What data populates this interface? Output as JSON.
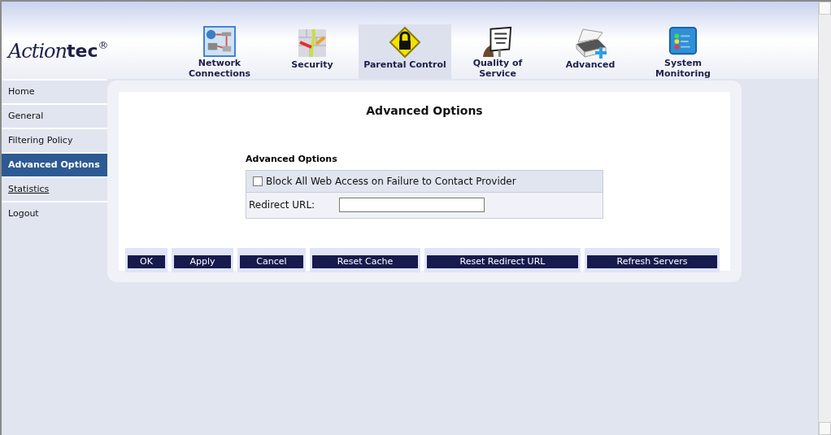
{
  "logo": {
    "text": "Action",
    "bold": "tec",
    "mark": "®"
  },
  "nav": [
    {
      "label": "Network Connections",
      "kind": "network",
      "selected": false
    },
    {
      "label": "Security",
      "kind": "security",
      "selected": false
    },
    {
      "label": "Parental Control",
      "kind": "lock",
      "selected": true
    },
    {
      "label": "Quality of Service",
      "kind": "sign",
      "selected": false
    },
    {
      "label": "Advanced",
      "kind": "scanner",
      "selected": false
    },
    {
      "label": "System Monitoring",
      "kind": "monitor",
      "selected": false
    }
  ],
  "sidebar": [
    {
      "label": "Home",
      "selected": false,
      "link": false
    },
    {
      "label": "General",
      "selected": false,
      "link": false
    },
    {
      "label": "Filtering Policy",
      "selected": false,
      "link": false
    },
    {
      "label": "Advanced Options",
      "selected": true,
      "link": false
    },
    {
      "label": "Statistics",
      "selected": false,
      "link": true
    },
    {
      "label": "Logout",
      "selected": false,
      "link": false
    }
  ],
  "page_title": "Advanced Options",
  "section": {
    "title": "Advanced Options",
    "checkbox": {
      "label": "Block All Web Access on Failure to Contact Provider",
      "checked": false
    },
    "field": {
      "label": "Redirect URL:"
    }
  },
  "buttons": [
    "OK",
    "Apply",
    "Cancel",
    "Reset Cache",
    "Reset Redirect URL",
    "Refresh Servers"
  ]
}
